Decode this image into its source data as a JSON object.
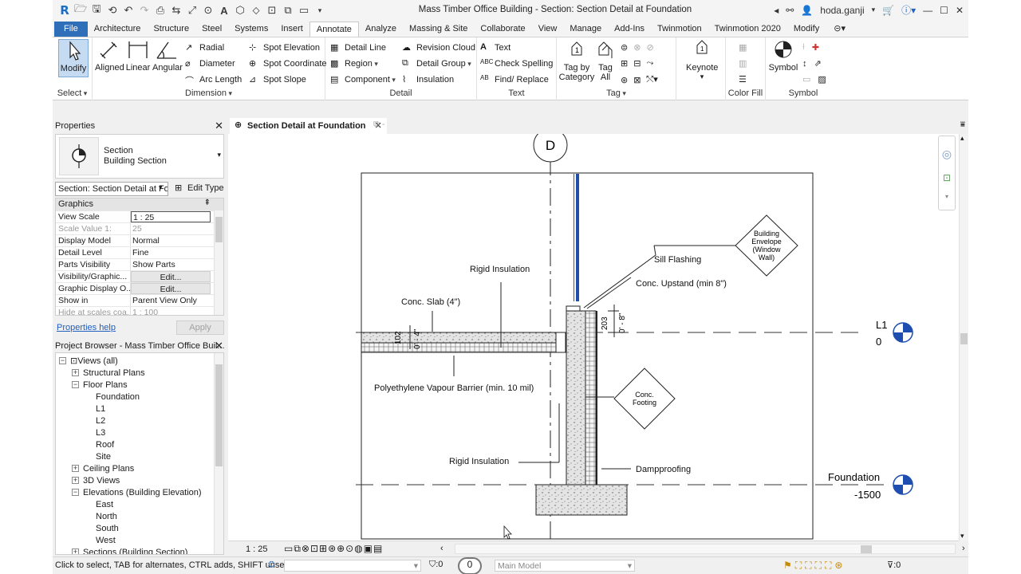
{
  "window": {
    "title": "Mass Timber Office Building - Section: Section Detail at Foundation",
    "user": "hoda.ganji"
  },
  "ribbon_tabs": [
    "File",
    "Architecture",
    "Structure",
    "Steel",
    "Systems",
    "Insert",
    "Annotate",
    "Analyze",
    "Massing & Site",
    "Collaborate",
    "View",
    "Manage",
    "Add-Ins",
    "Twinmotion",
    "Twinmotion 2020",
    "Modify"
  ],
  "active_tab": "Annotate",
  "ribbon": {
    "select": {
      "label": "Select",
      "modify": "Modify"
    },
    "dimension": {
      "label": "Dimension",
      "aligned": "Aligned",
      "linear": "Linear",
      "angular": "Angular",
      "radial": "Radial",
      "diameter": "Diameter",
      "arc_length": "Arc  Length",
      "spot_elevation": "Spot  Elevation",
      "spot_coordinate": "Spot  Coordinate",
      "spot_slope": "Spot  Slope"
    },
    "detail": {
      "label": "Detail",
      "detail_line": "Detail  Line",
      "region": "Region",
      "component": "Component",
      "revision_cloud": "Revision  Cloud",
      "detail_group": "Detail  Group",
      "insulation": "Insulation"
    },
    "text": {
      "label": "Text",
      "text": "Text",
      "check_spelling": "Check  Spelling",
      "find_replace": "Find/  Replace"
    },
    "tag": {
      "label": "Tag",
      "tag_by_category": "Tag by Category",
      "tag_all": "Tag All"
    },
    "keynote": "Keynote",
    "color_fill": "Color Fill",
    "symbol": {
      "label": "Symbol",
      "symbol": "Symbol"
    }
  },
  "properties": {
    "title": "Properties",
    "type_name": "Section",
    "type_sub": "Building Section",
    "instance": "Section: Section Detail at Fo",
    "edit_type": "Edit Type",
    "group": "Graphics",
    "rows": [
      {
        "k": "View Scale",
        "v": "1 : 25",
        "style": "box"
      },
      {
        "k": "Scale Value    1:",
        "v": "25",
        "style": "grey"
      },
      {
        "k": "Display Model",
        "v": "Normal",
        "style": ""
      },
      {
        "k": "Detail Level",
        "v": "Fine",
        "style": ""
      },
      {
        "k": "Parts Visibility",
        "v": "Show Parts",
        "style": ""
      },
      {
        "k": "Visibility/Graphic...",
        "v": "Edit...",
        "style": "btn"
      },
      {
        "k": "Graphic Display O...",
        "v": "Edit...",
        "style": "btn"
      },
      {
        "k": "Show in",
        "v": "Parent View Only",
        "style": ""
      },
      {
        "k": "Hide at scales coa...",
        "v": "1 : 100",
        "style": "grey"
      }
    ],
    "help": "Properties help",
    "apply": "Apply"
  },
  "browser": {
    "title": "Project Browser - Mass Timber Office Buil...",
    "nodes": [
      {
        "label": "Views (all)",
        "level": 0,
        "tog": "−"
      },
      {
        "label": "Structural Plans",
        "level": 1,
        "tog": "+"
      },
      {
        "label": "Floor Plans",
        "level": 1,
        "tog": "−"
      },
      {
        "label": "Foundation",
        "level": 2,
        "tog": ""
      },
      {
        "label": "L1",
        "level": 2,
        "tog": ""
      },
      {
        "label": "L2",
        "level": 2,
        "tog": ""
      },
      {
        "label": "L3",
        "level": 2,
        "tog": ""
      },
      {
        "label": "Roof",
        "level": 2,
        "tog": ""
      },
      {
        "label": "Site",
        "level": 2,
        "tog": ""
      },
      {
        "label": "Ceiling Plans",
        "level": 1,
        "tog": "+"
      },
      {
        "label": "3D Views",
        "level": 1,
        "tog": "+"
      },
      {
        "label": "Elevations (Building Elevation)",
        "level": 1,
        "tog": "−"
      },
      {
        "label": "East",
        "level": 2,
        "tog": ""
      },
      {
        "label": "North",
        "level": 2,
        "tog": ""
      },
      {
        "label": "South",
        "level": 2,
        "tog": ""
      },
      {
        "label": "West",
        "level": 2,
        "tog": ""
      },
      {
        "label": "Sections (Building Section)",
        "level": 1,
        "tog": "+"
      }
    ]
  },
  "view": {
    "tab": "Section Detail at Foundation",
    "scale": "1 : 25",
    "grid_bubble": "D",
    "labels": {
      "rigid_insulation_top": "Rigid Insulation",
      "conc_slab": "Conc. Slab (4\")",
      "sill_flashing": "Sill Flashing",
      "conc_upstand": "Conc. Upstand (min 8\")",
      "vapour_barrier": "Polyethylene Vapour Barrier (min. 10 mil)",
      "rigid_insulation_bottom": "Rigid Insulation",
      "dampproofing": "Dampproofing",
      "dim_102": "102",
      "dim_0_4": "0' - 4\"",
      "dim_203": "203",
      "dim_0_8": "0' - 8\""
    },
    "keynotes": {
      "envelope": [
        "Building",
        "Envelope",
        "(Window",
        "Wall)"
      ],
      "footing": [
        "Conc.",
        "Footing"
      ]
    },
    "levels": [
      {
        "name": "L1",
        "elev": "0"
      },
      {
        "name": "Foundation",
        "elev": "-1500"
      }
    ]
  },
  "status": {
    "hint": "Click to select, TAB for alternates, CTRL adds, SHIFT unselect",
    "count": ":0",
    "model": "Main Model",
    "filter": ":0"
  }
}
